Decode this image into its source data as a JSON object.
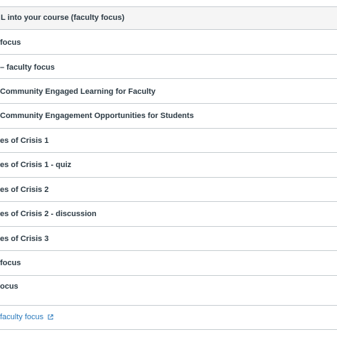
{
  "module": {
    "title": "L into your course (faculty focus)"
  },
  "items": [
    {
      "label": "focus"
    },
    {
      "label": "– faculty focus"
    },
    {
      "label": "Community Engaged Learning for Faculty"
    },
    {
      "label": "Community Engagement Opportunities for Students"
    },
    {
      "label": "es of Crisis 1"
    },
    {
      "label": "es of Crisis 1 - quiz"
    },
    {
      "label": "es of Crisis 2"
    },
    {
      "label": "es of Crisis 2 - discussion"
    },
    {
      "label": "es of Crisis 3"
    },
    {
      "label": " focus"
    },
    {
      "label": "ocus"
    },
    {
      "label": "faculty focus",
      "external": true
    }
  ],
  "colors": {
    "text": "#2d3b45",
    "link": "#2b7abc",
    "border": "#c7cdd1",
    "header_bg": "#f5f5f5"
  }
}
